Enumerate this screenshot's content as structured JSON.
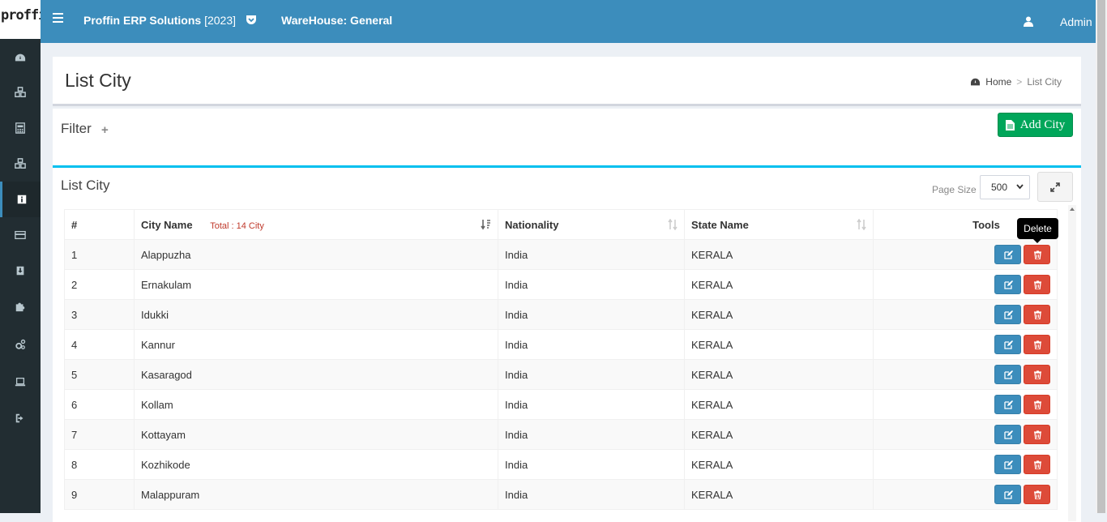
{
  "sidebar": {
    "logo_text": "proffin",
    "items": [
      {
        "icon": "dashboard-icon"
      },
      {
        "icon": "cubes-icon"
      },
      {
        "icon": "calculator-icon"
      },
      {
        "icon": "cubes-icon"
      },
      {
        "icon": "info-icon"
      },
      {
        "icon": "credit-card-icon"
      },
      {
        "icon": "download-icon"
      },
      {
        "icon": "puzzle-icon"
      },
      {
        "icon": "cogs-icon"
      },
      {
        "icon": "laptop-icon"
      },
      {
        "icon": "sign-out-icon"
      }
    ]
  },
  "header": {
    "app_title": "Proffin ERP Solutions",
    "year": "[2023]",
    "warehouse": "WareHouse: General",
    "user": "Admin"
  },
  "title_box": {
    "title": "List City",
    "breadcrumb": {
      "home": "Home",
      "sep": ">",
      "current": "List City"
    }
  },
  "filter": {
    "title": "Filter",
    "add_label": "Add City"
  },
  "list": {
    "title": "List City",
    "page_size_label": "Page Size",
    "page_size": "500",
    "columns": {
      "num": "#",
      "city": "City Name",
      "total": "Total : 14 City",
      "nationality": "Nationality",
      "state": "State Name",
      "tools": "Tools"
    },
    "rows": [
      {
        "num": "1",
        "city": "Alappuzha",
        "nationality": "India",
        "state": "KERALA"
      },
      {
        "num": "2",
        "city": "Ernakulam",
        "nationality": "India",
        "state": "KERALA"
      },
      {
        "num": "3",
        "city": "Idukki",
        "nationality": "India",
        "state": "KERALA"
      },
      {
        "num": "4",
        "city": "Kannur",
        "nationality": "India",
        "state": "KERALA"
      },
      {
        "num": "5",
        "city": "Kasaragod",
        "nationality": "India",
        "state": "KERALA"
      },
      {
        "num": "6",
        "city": "Kollam",
        "nationality": "India",
        "state": "KERALA"
      },
      {
        "num": "7",
        "city": "Kottayam",
        "nationality": "India",
        "state": "KERALA"
      },
      {
        "num": "8",
        "city": "Kozhikode",
        "nationality": "India",
        "state": "KERALA"
      },
      {
        "num": "9",
        "city": "Malappuram",
        "nationality": "India",
        "state": "KERALA"
      }
    ],
    "tooltip": "Delete"
  },
  "colors": {
    "header": "#3c8dbc",
    "sidebar": "#222d32",
    "success": "#00a65a",
    "danger": "#dd4b39",
    "info_border": "#00c0ef"
  }
}
